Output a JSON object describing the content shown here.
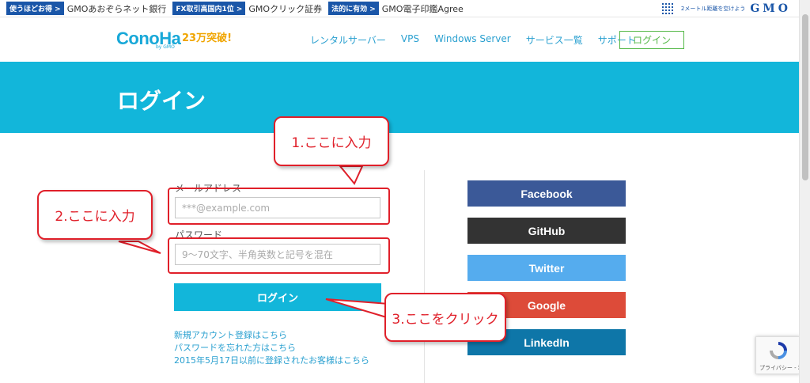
{
  "topbar": {
    "promos": [
      {
        "tag": "使うほどお得 >",
        "text": "GMOあおぞらネット銀行"
      },
      {
        "tag": "FX取引高国内1位 >",
        "text": "GMOクリック証券"
      },
      {
        "tag": "法的に有効 >",
        "text": "GMO電子印鑑Agree"
      }
    ],
    "slogan": "2メートル距離を空けよう",
    "gmo_logo": "GMO"
  },
  "header": {
    "logo": "ConoHa",
    "logo_sub": "by GMO",
    "badge": "23万突破!",
    "nav": [
      "レンタルサーバー",
      "VPS",
      "Windows Server",
      "サービス一覧",
      "サポート"
    ],
    "login_button": "ログイン"
  },
  "hero": {
    "title": "ログイン"
  },
  "form": {
    "email_label": "メールアドレス",
    "email_placeholder": "***@example.com",
    "password_label": "パスワード",
    "password_placeholder": "9～70文字、半角英数と記号を混在",
    "submit": "ログイン",
    "links": [
      "新規アカウント登録はこちら",
      "パスワードを忘れた方はこちら",
      "2015年5月17日以前に登録されたお客様はこちら"
    ]
  },
  "social": [
    {
      "label": "Facebook",
      "color": "#3b5998"
    },
    {
      "label": "GitHub",
      "color": "#333333"
    },
    {
      "label": "Twitter",
      "color": "#55acee"
    },
    {
      "label": "Google",
      "color": "#dd4b39"
    },
    {
      "label": "LinkedIn",
      "color": "#0e76a8"
    }
  ],
  "annotations": {
    "callout1": "1.ここに入力",
    "callout2": "2.ここに入力",
    "callout3": "3.ここをクリック"
  },
  "recaptcha": {
    "text": "プライバシー - 利用規約"
  }
}
